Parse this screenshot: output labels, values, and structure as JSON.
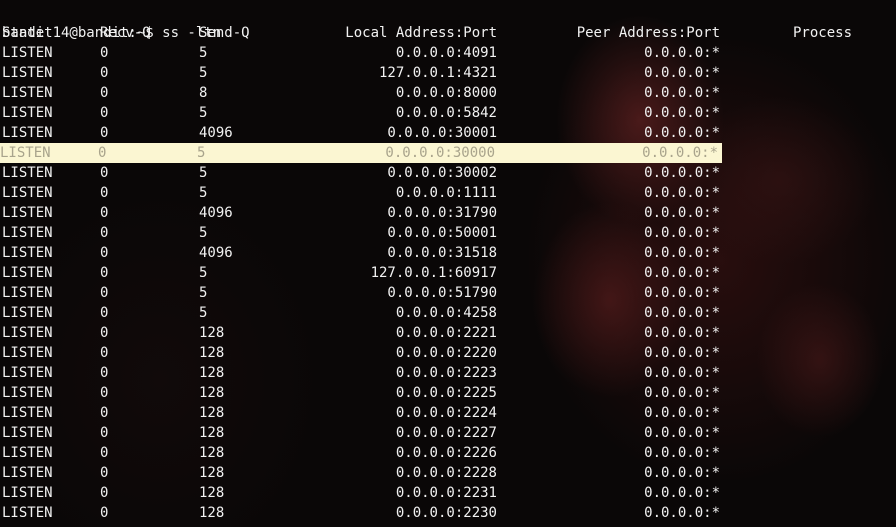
{
  "terminal": {
    "prompt": "bandit14@bandit:~$ ss -ltn",
    "headers": {
      "state": "State",
      "recv": "Recv-Q",
      "send": "Send-Q",
      "local": "Local Address:Port",
      "peer": "Peer Address:Port",
      "process": "Process"
    },
    "highlighted_row": 5,
    "rows": [
      {
        "state": "LISTEN",
        "recv": "0",
        "send": "5",
        "local": "0.0.0.0:4091",
        "peer": "0.0.0.0:*"
      },
      {
        "state": "LISTEN",
        "recv": "0",
        "send": "5",
        "local": "127.0.0.1:4321",
        "peer": "0.0.0.0:*"
      },
      {
        "state": "LISTEN",
        "recv": "0",
        "send": "8",
        "local": "0.0.0.0:8000",
        "peer": "0.0.0.0:*"
      },
      {
        "state": "LISTEN",
        "recv": "0",
        "send": "5",
        "local": "0.0.0.0:5842",
        "peer": "0.0.0.0:*"
      },
      {
        "state": "LISTEN",
        "recv": "0",
        "send": "4096",
        "local": "0.0.0.0:30001",
        "peer": "0.0.0.0:*"
      },
      {
        "state": "LISTEN",
        "recv": "0",
        "send": "5",
        "local": "0.0.0.0:30000",
        "peer": "0.0.0.0:*"
      },
      {
        "state": "LISTEN",
        "recv": "0",
        "send": "5",
        "local": "0.0.0.0:30002",
        "peer": "0.0.0.0:*"
      },
      {
        "state": "LISTEN",
        "recv": "0",
        "send": "5",
        "local": "0.0.0.0:1111",
        "peer": "0.0.0.0:*"
      },
      {
        "state": "LISTEN",
        "recv": "0",
        "send": "4096",
        "local": "0.0.0.0:31790",
        "peer": "0.0.0.0:*"
      },
      {
        "state": "LISTEN",
        "recv": "0",
        "send": "5",
        "local": "0.0.0.0:50001",
        "peer": "0.0.0.0:*"
      },
      {
        "state": "LISTEN",
        "recv": "0",
        "send": "4096",
        "local": "0.0.0.0:31518",
        "peer": "0.0.0.0:*"
      },
      {
        "state": "LISTEN",
        "recv": "0",
        "send": "5",
        "local": "127.0.0.1:60917",
        "peer": "0.0.0.0:*"
      },
      {
        "state": "LISTEN",
        "recv": "0",
        "send": "5",
        "local": "0.0.0.0:51790",
        "peer": "0.0.0.0:*"
      },
      {
        "state": "LISTEN",
        "recv": "0",
        "send": "5",
        "local": "0.0.0.0:4258",
        "peer": "0.0.0.0:*"
      },
      {
        "state": "LISTEN",
        "recv": "0",
        "send": "128",
        "local": "0.0.0.0:2221",
        "peer": "0.0.0.0:*"
      },
      {
        "state": "LISTEN",
        "recv": "0",
        "send": "128",
        "local": "0.0.0.0:2220",
        "peer": "0.0.0.0:*"
      },
      {
        "state": "LISTEN",
        "recv": "0",
        "send": "128",
        "local": "0.0.0.0:2223",
        "peer": "0.0.0.0:*"
      },
      {
        "state": "LISTEN",
        "recv": "0",
        "send": "128",
        "local": "0.0.0.0:2225",
        "peer": "0.0.0.0:*"
      },
      {
        "state": "LISTEN",
        "recv": "0",
        "send": "128",
        "local": "0.0.0.0:2224",
        "peer": "0.0.0.0:*"
      },
      {
        "state": "LISTEN",
        "recv": "0",
        "send": "128",
        "local": "0.0.0.0:2227",
        "peer": "0.0.0.0:*"
      },
      {
        "state": "LISTEN",
        "recv": "0",
        "send": "128",
        "local": "0.0.0.0:2226",
        "peer": "0.0.0.0:*"
      },
      {
        "state": "LISTEN",
        "recv": "0",
        "send": "128",
        "local": "0.0.0.0:2228",
        "peer": "0.0.0.0:*"
      },
      {
        "state": "LISTEN",
        "recv": "0",
        "send": "128",
        "local": "0.0.0.0:2231",
        "peer": "0.0.0.0:*"
      },
      {
        "state": "LISTEN",
        "recv": "0",
        "send": "128",
        "local": "0.0.0.0:2230",
        "peer": "0.0.0.0:*"
      }
    ]
  },
  "colors": {
    "foreground": "#f2f2f2",
    "highlight_bg": "#fbf6d2",
    "background": "#0a0707",
    "wallpaper_accent": "#7a2828"
  }
}
